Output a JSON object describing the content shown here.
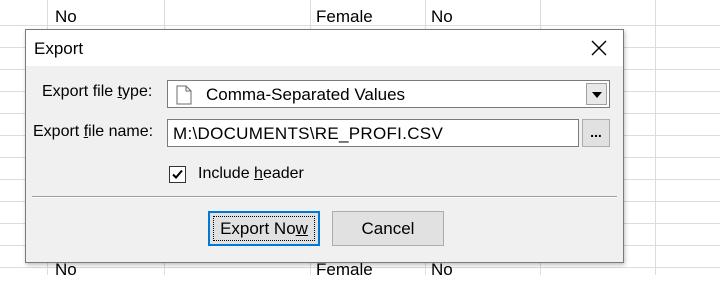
{
  "background": {
    "rows_top": [
      {
        "c1": "No",
        "c2": "Female",
        "c3": "No"
      }
    ],
    "rows_bottom": [
      {
        "c1": "No",
        "c2": "Female",
        "c3": "No"
      }
    ]
  },
  "dialog": {
    "title": "Export",
    "close_icon": "close-icon",
    "file_type_label_pre": "Export file ",
    "file_type_label_ul": "t",
    "file_type_label_post": "ype:",
    "file_type_value": "Comma-Separated Values",
    "file_name_label_pre": "Export ",
    "file_name_label_ul": "f",
    "file_name_label_post": "ile name:",
    "file_name_value": "M:\\DOCUMENTS\\RE_PROFI.CSV",
    "browse_label": "...",
    "include_header_checked": true,
    "include_header_pre": "Include ",
    "include_header_ul": "h",
    "include_header_post": "eader",
    "export_now_pre": "Export No",
    "export_now_ul": "w",
    "cancel_label": "Cancel"
  },
  "colors": {
    "dialog_bg": "#f0f0f0",
    "default_button_border": "#0078d7",
    "grid_line": "#dcdcdc"
  }
}
